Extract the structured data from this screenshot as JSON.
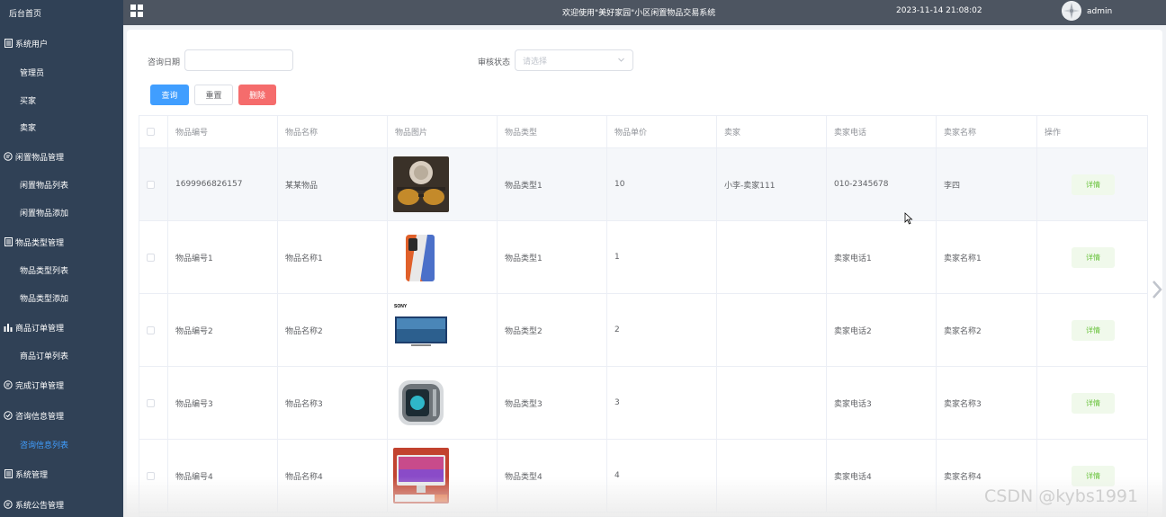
{
  "sidebar": {
    "home": "后台首页",
    "groups": [
      {
        "label": "系统用户",
        "icon": "document-icon",
        "children": [
          "管理员",
          "买家",
          "卖家"
        ]
      },
      {
        "label": "闲置物品管理",
        "icon": "chat-icon",
        "children": [
          "闲置物品列表",
          "闲置物品添加"
        ]
      },
      {
        "label": "物品类型管理",
        "icon": "document-icon",
        "children": [
          "物品类型列表",
          "物品类型添加"
        ]
      },
      {
        "label": "商品订单管理",
        "icon": "bar-chart-icon",
        "children": [
          "商品订单列表"
        ]
      },
      {
        "label": "完成订单管理",
        "icon": "chat-icon",
        "children": []
      },
      {
        "label": "咨询信息管理",
        "icon": "check-circle-icon",
        "children": [
          "咨询信息列表"
        ]
      },
      {
        "label": "系统管理",
        "icon": "document-icon",
        "children": []
      },
      {
        "label": "系统公告管理",
        "icon": "chat-icon",
        "children": []
      }
    ],
    "active_item": "咨询信息列表",
    "colors": {
      "background": "#304156",
      "active": "#409eff"
    }
  },
  "header": {
    "title": "欢迎使用\"美好家园\"小区闲置物品交易系统",
    "datetime": "2023-11-14 21:08:02",
    "username": "admin",
    "menu_icon": "grid-menu-icon"
  },
  "search": {
    "date_label": "咨询日期",
    "date_value": "",
    "status_label": "审核状态",
    "status_placeholder": "请选择",
    "query_button": "查询",
    "reset_button": "重置",
    "delete_button": "删除"
  },
  "table": {
    "headers": [
      "物品编号",
      "物品名称",
      "物品图片",
      "物品类型",
      "物品单价",
      "卖家",
      "卖家电话",
      "卖家名称",
      "操作"
    ],
    "rows": [
      {
        "code": "1699966826157",
        "name": "某某物品",
        "image": "sunglasses-photo",
        "type": "物品类型1",
        "price": "10",
        "seller": "小李-卖家111",
        "phone": "010-2345678",
        "seller_name": "李四",
        "action": "详情"
      },
      {
        "code": "物品编号1",
        "name": "物品名称1",
        "image": "phone-photo",
        "type": "物品类型1",
        "price": "1",
        "seller": "",
        "phone": "卖家电话1",
        "seller_name": "卖家名称1",
        "action": "详情"
      },
      {
        "code": "物品编号2",
        "name": "物品名称2",
        "image": "tv-photo",
        "image_brand": "SONY",
        "type": "物品类型2",
        "price": "2",
        "seller": "",
        "phone": "卖家电话2",
        "seller_name": "卖家名称2",
        "action": "详情"
      },
      {
        "code": "物品编号3",
        "name": "物品名称3",
        "image": "desktop-pc-photo",
        "type": "物品类型3",
        "price": "3",
        "seller": "",
        "phone": "卖家电话3",
        "seller_name": "卖家名称3",
        "action": "详情"
      },
      {
        "code": "物品编号4",
        "name": "物品名称4",
        "image": "imac-photo",
        "type": "物品类型4",
        "price": "4",
        "seller": "",
        "phone": "卖家电话4",
        "seller_name": "卖家名称4",
        "action": "详情"
      }
    ]
  },
  "watermark": "CSDN @kybs1991"
}
